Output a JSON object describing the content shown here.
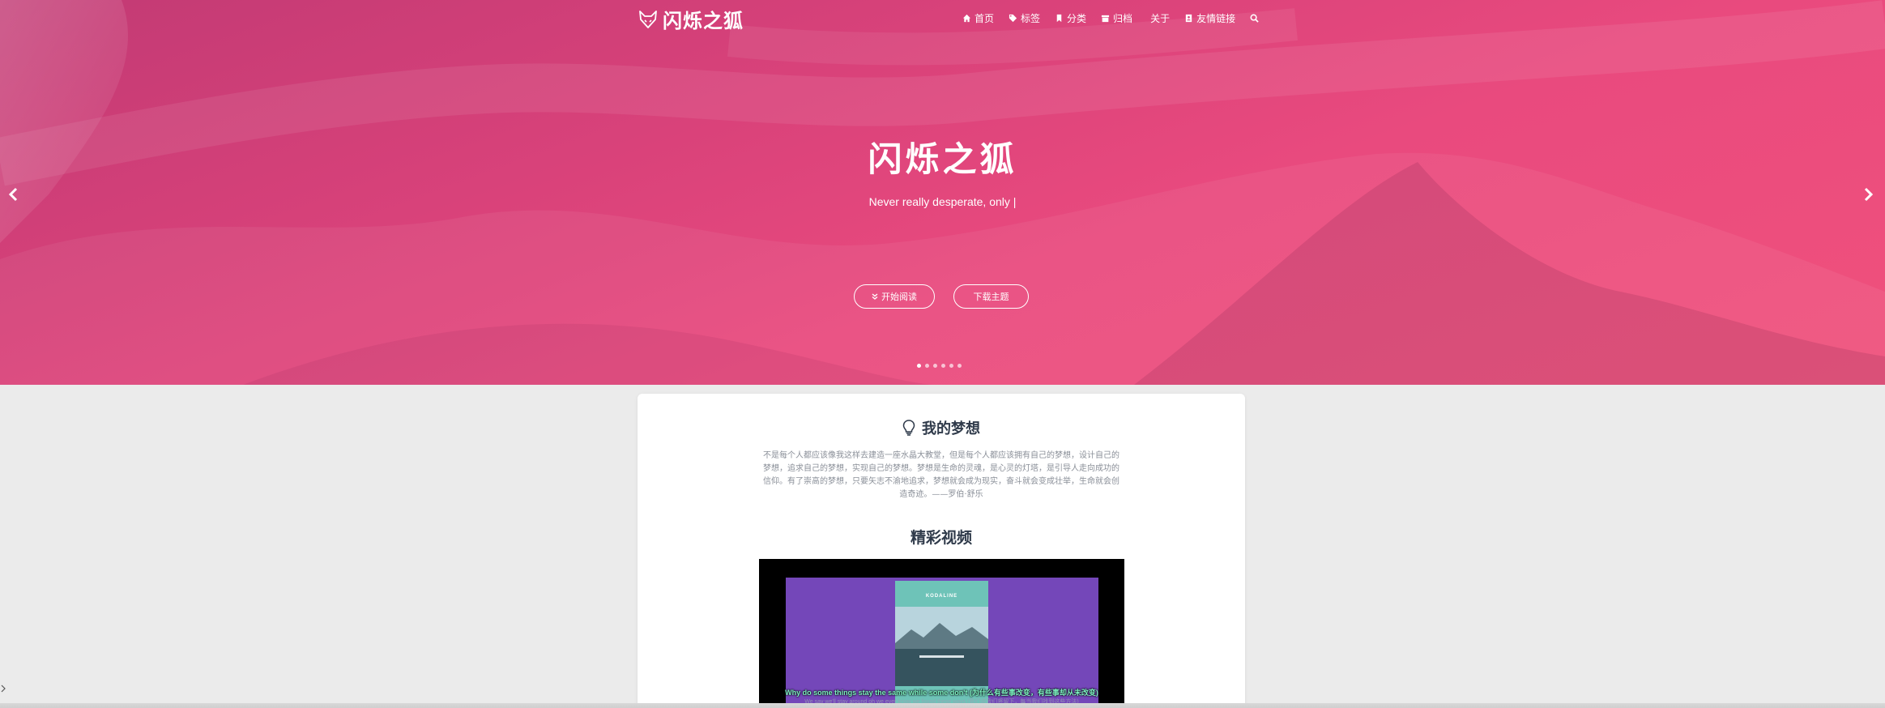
{
  "brand": {
    "logo_text": "闪烁之狐"
  },
  "nav": {
    "items": [
      {
        "label": "首页",
        "icon": "home-icon"
      },
      {
        "label": "标签",
        "icon": "tags-icon"
      },
      {
        "label": "分类",
        "icon": "bookmark-icon"
      },
      {
        "label": "归档",
        "icon": "archive-icon"
      },
      {
        "label": "关于",
        "icon": ""
      },
      {
        "label": "友情链接",
        "icon": "address-book-icon"
      }
    ],
    "search_icon": "search-icon"
  },
  "hero": {
    "title": "闪烁之狐",
    "subtitle": "Never really desperate, only |",
    "read_button": "开始阅读",
    "download_button": "下载主题",
    "slides_count": 6,
    "active_slide": 1,
    "colors": {
      "gradient_start": "#c23a74",
      "gradient_end": "#f0517c"
    }
  },
  "dream": {
    "title": "我的梦想",
    "text": "不是每个人都应该像我这样去建造一座水晶大教堂，但是每个人都应该拥有自己的梦想，设计自己的梦想，追求自己的梦想，实现自己的梦想。梦想是生命的灵魂，是心灵的灯塔，是引导人走向成功的信仰。有了崇高的梦想，只要矢志不渝地追求，梦想就会成为现实，奋斗就会变成壮举，生命就会创造奇迹。——罗伯·舒乐"
  },
  "video": {
    "title": "精彩视频",
    "phone_brand": "KODALINE",
    "subtitle_line1": "Why do some things stay the same while some don't (为什么有些事改变，有些事却从未改变)",
    "subtitle_line2": "We say we'll stay around oh we ever know we found these ways (我们说我们将留下，每当我们找到这些方法)"
  }
}
